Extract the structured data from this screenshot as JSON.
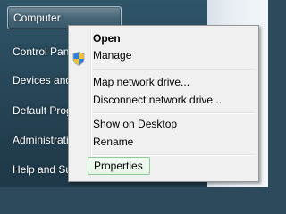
{
  "start_menu": {
    "items": [
      {
        "label": "Computer"
      },
      {
        "label": "Control Panel"
      },
      {
        "label": "Devices and Printers"
      },
      {
        "label": "Default Programs"
      },
      {
        "label": "Administrative Tools"
      },
      {
        "label": "Help and Support"
      }
    ]
  },
  "context_menu": {
    "items": [
      {
        "label": "Open"
      },
      {
        "label": "Manage",
        "icon": "uac-shield-icon"
      },
      {
        "label": "Map network drive..."
      },
      {
        "label": "Disconnect network drive..."
      },
      {
        "label": "Show on Desktop"
      },
      {
        "label": "Rename"
      },
      {
        "label": "Properties"
      }
    ]
  },
  "colors": {
    "panel": "#294a5c",
    "menu_bg": "#f0f0f0",
    "hover_border": "#8fcb96"
  }
}
